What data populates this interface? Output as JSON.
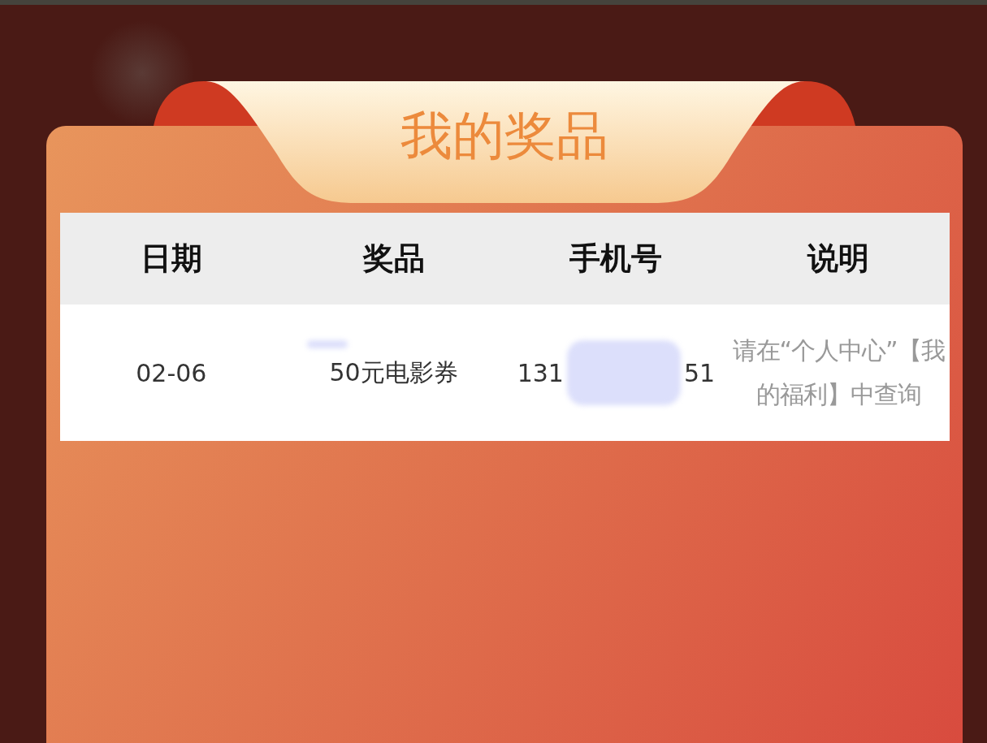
{
  "title": "我的奖品",
  "table": {
    "columns": [
      "日期",
      "奖品",
      "手机号",
      "说明"
    ],
    "rows": [
      {
        "date": "02-06",
        "prize": "50元电影券",
        "phone_parts": [
          "131",
          "51"
        ],
        "note": "请在“个人中心”【我的福利】中查询"
      }
    ]
  }
}
